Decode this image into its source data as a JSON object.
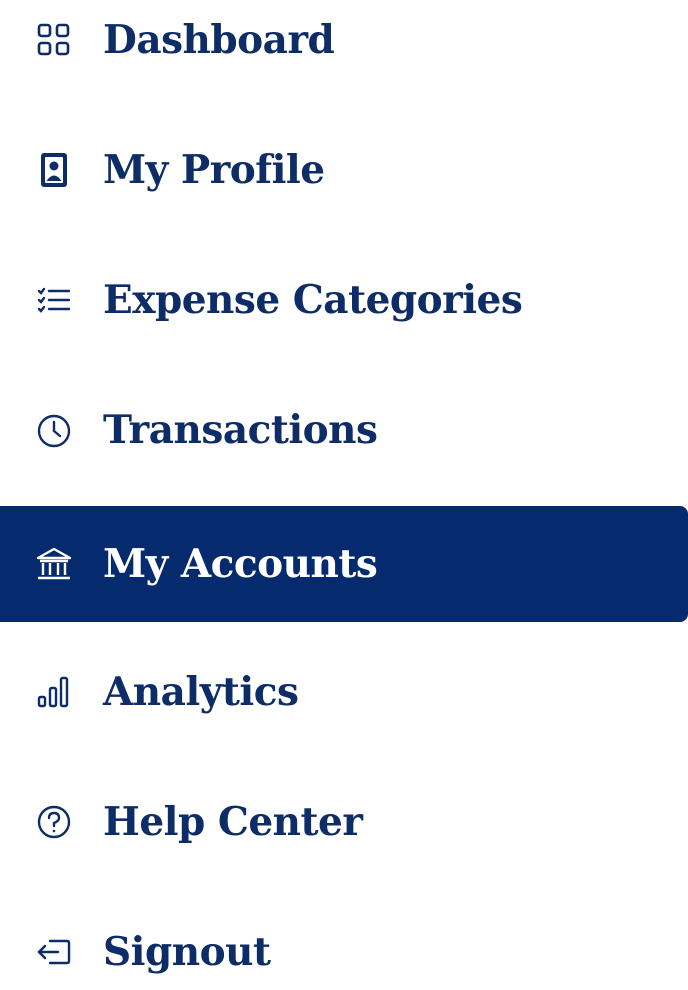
{
  "colors": {
    "active_background": "#052a6e",
    "text": "#0e2c66",
    "active_text": "#ffffff",
    "background": "#ffffff"
  },
  "nav": {
    "items": [
      {
        "label": "Dashboard",
        "icon": "grid-icon",
        "active": false
      },
      {
        "label": "My Profile",
        "icon": "profile-card-icon",
        "active": false
      },
      {
        "label": "Expense Categories",
        "icon": "list-icon",
        "active": false
      },
      {
        "label": "Transactions",
        "icon": "clock-icon",
        "active": false
      },
      {
        "label": "My Accounts",
        "icon": "bank-icon",
        "active": true
      },
      {
        "label": "Analytics",
        "icon": "bar-chart-icon",
        "active": false
      },
      {
        "label": "Help Center",
        "icon": "help-circle-icon",
        "active": false
      },
      {
        "label": "Signout",
        "icon": "signout-icon",
        "active": false
      }
    ]
  }
}
